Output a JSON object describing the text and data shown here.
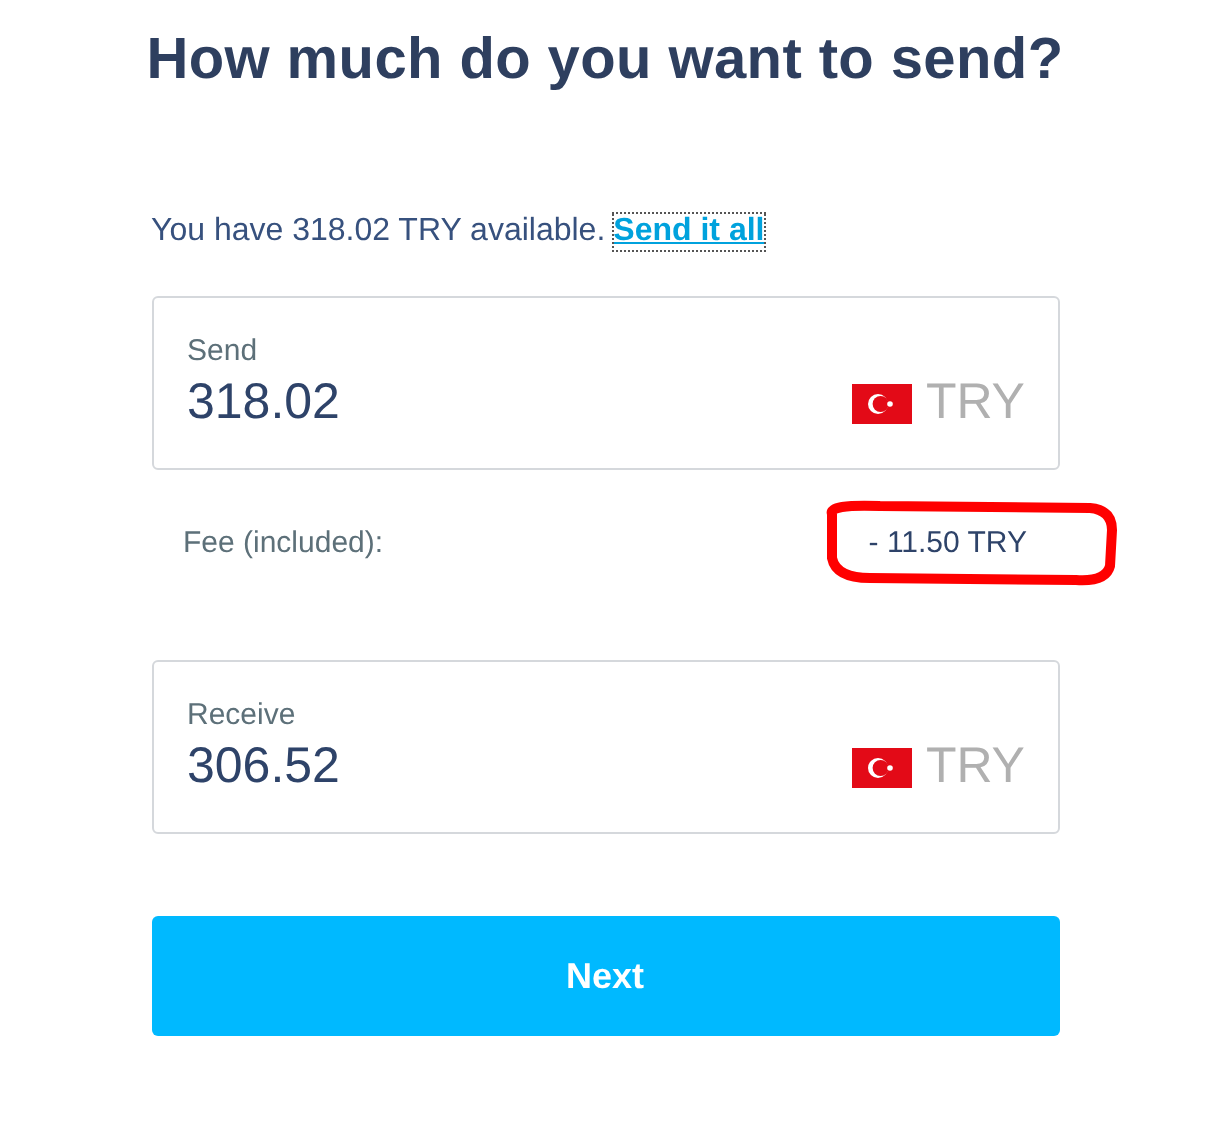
{
  "title": "How much do you want to send?",
  "balance": {
    "text": "You have 318.02 TRY available.",
    "link": "Send it all"
  },
  "send": {
    "label": "Send",
    "value": "318.02",
    "currency": "TRY"
  },
  "fee": {
    "label": "Fee (included):",
    "amount": "- 11.50 TRY",
    "circled": true
  },
  "receive": {
    "label": "Receive",
    "value": "306.52",
    "currency": "TRY"
  },
  "button": "Next"
}
